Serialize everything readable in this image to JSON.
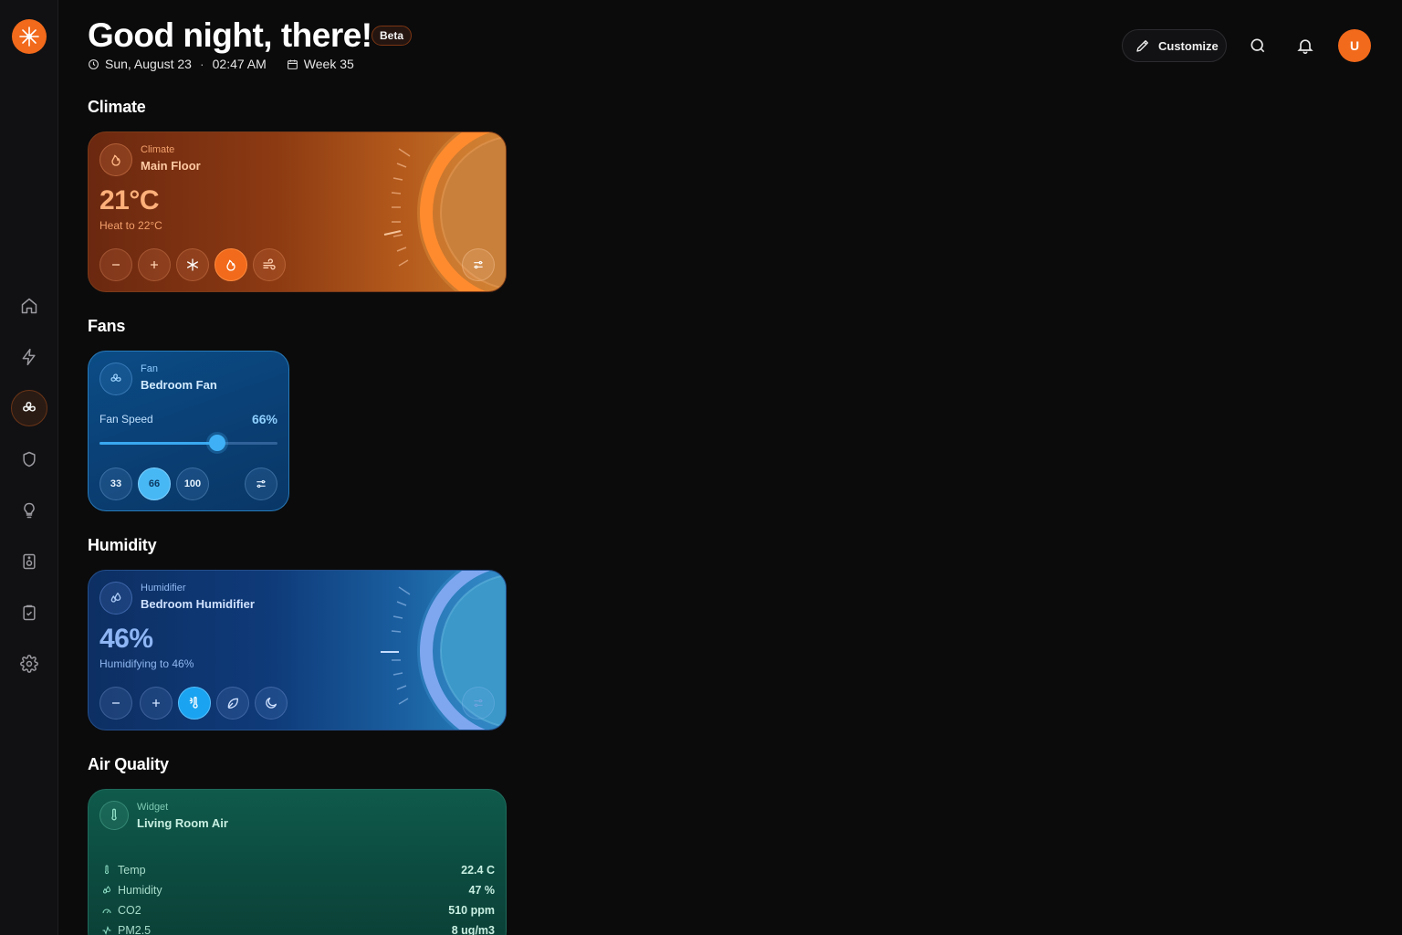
{
  "header": {
    "greeting": "Good night, there!",
    "badge": "Beta",
    "date": "Sun, August 23",
    "separator": "·",
    "time": "02:47 AM",
    "week": "Week 35",
    "customize_label": "Customize",
    "avatar_initial": "U"
  },
  "sidebar": {
    "items": [
      {
        "icon": "home-icon"
      },
      {
        "icon": "lightning-icon"
      },
      {
        "icon": "fan-icon",
        "active": true
      },
      {
        "icon": "shield-icon"
      },
      {
        "icon": "lightbulb-icon"
      },
      {
        "icon": "speaker-icon"
      },
      {
        "icon": "clipboard-check-icon"
      },
      {
        "icon": "gear-icon"
      }
    ]
  },
  "sections": {
    "climate": "Climate",
    "fans": "Fans",
    "humidity": "Humidity",
    "air_quality": "Air Quality"
  },
  "climate_card": {
    "kicker": "Climate",
    "name": "Main Floor",
    "temperature": "21°C",
    "target": "Heat to 22°C",
    "active_mode": "heat",
    "accent": "#f26a1b"
  },
  "fan_card": {
    "kicker": "Fan",
    "name": "Bedroom Fan",
    "speed_label": "Fan Speed",
    "speed_value": "66%",
    "speed_fraction": 0.66,
    "presets": [
      "33",
      "66",
      "100"
    ],
    "active_preset": "66",
    "accent": "#48b8f5"
  },
  "humidity_card": {
    "kicker": "Humidifier",
    "name": "Bedroom Humidifier",
    "humidity": "46%",
    "target": "Humidifying to 46%",
    "active_mode": "auto",
    "accent": "#1aa3f0"
  },
  "air_card": {
    "kicker": "Widget",
    "name": "Living Room Air",
    "rows": [
      {
        "label": "Temp",
        "value": "22.4 C",
        "icon": "thermometer-icon"
      },
      {
        "label": "Humidity",
        "value": "47 %",
        "icon": "droplets-icon"
      },
      {
        "label": "CO2",
        "value": "510 ppm",
        "icon": "gauge-icon"
      },
      {
        "label": "PM2.5",
        "value": "8 ug/m3",
        "icon": "activity-icon"
      }
    ]
  }
}
